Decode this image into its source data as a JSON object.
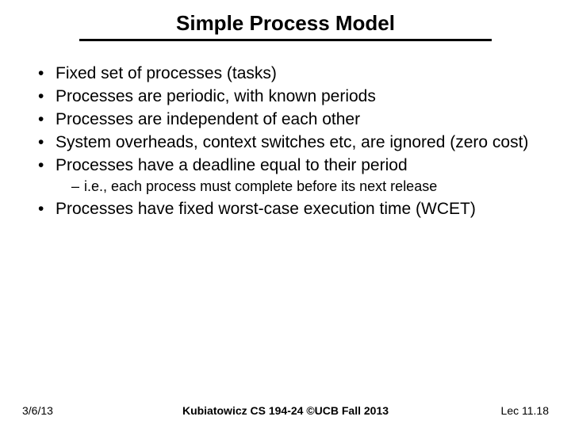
{
  "title": "Simple Process Model",
  "bullets": {
    "b0": "Fixed set of processes (tasks)",
    "b1": "Processes are periodic, with known periods",
    "b2": "Processes are independent of each other",
    "b3": "System overheads, context switches etc, are ignored (zero cost)",
    "b4": "Processes have a deadline equal to their period",
    "b4_sub0": "i.e., each process must complete before its next release",
    "b5": "Processes have fixed worst-case execution time (WCET)"
  },
  "footer": {
    "left": "3/6/13",
    "center": "Kubiatowicz CS 194-24 ©UCB Fall 2013",
    "right": "Lec 11.18"
  }
}
